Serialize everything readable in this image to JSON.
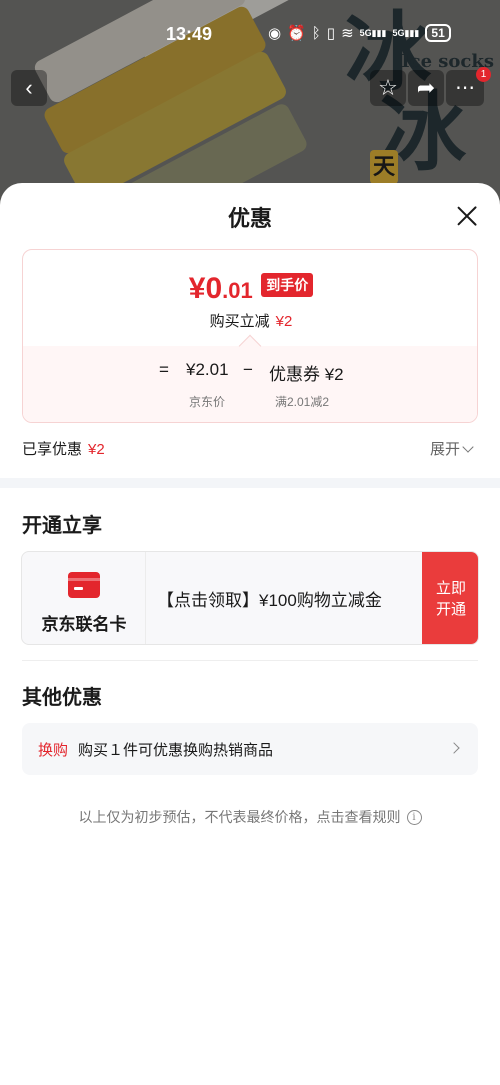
{
  "status_bar": {
    "time": "13:49",
    "battery": "51"
  },
  "banner": {
    "overlay_text": "Ice socks",
    "char": "冰",
    "badge_char": "天",
    "notification_count": "1"
  },
  "sheet": {
    "title": "优惠"
  },
  "price_card": {
    "currency": "¥",
    "final_price_int": "0",
    "final_price_dec": ".01",
    "final_price_tag": "到手价",
    "discount_label": "购买立减",
    "discount_value": "¥2",
    "equals": "=",
    "jd_price": "¥2.01",
    "minus": "−",
    "coupon": "优惠券 ¥2",
    "jd_price_label": "京东价",
    "coupon_rule": "满2.01减2"
  },
  "enjoyed": {
    "label": "已享优惠",
    "value": "¥2",
    "expand_label": "展开"
  },
  "open_section": {
    "title": "开通立享",
    "card_name": "京东联名卡",
    "offer": "【点击领取】¥100购物立减金",
    "open_button": [
      "立即",
      "开通"
    ]
  },
  "other_section": {
    "title": "其他优惠",
    "tag": "换购",
    "text": "购买１件可优惠换购热销商品"
  },
  "footnote": {
    "text": "以上仅为初步预估，不代表最终价格，点击查看规则",
    "icon": "i"
  }
}
